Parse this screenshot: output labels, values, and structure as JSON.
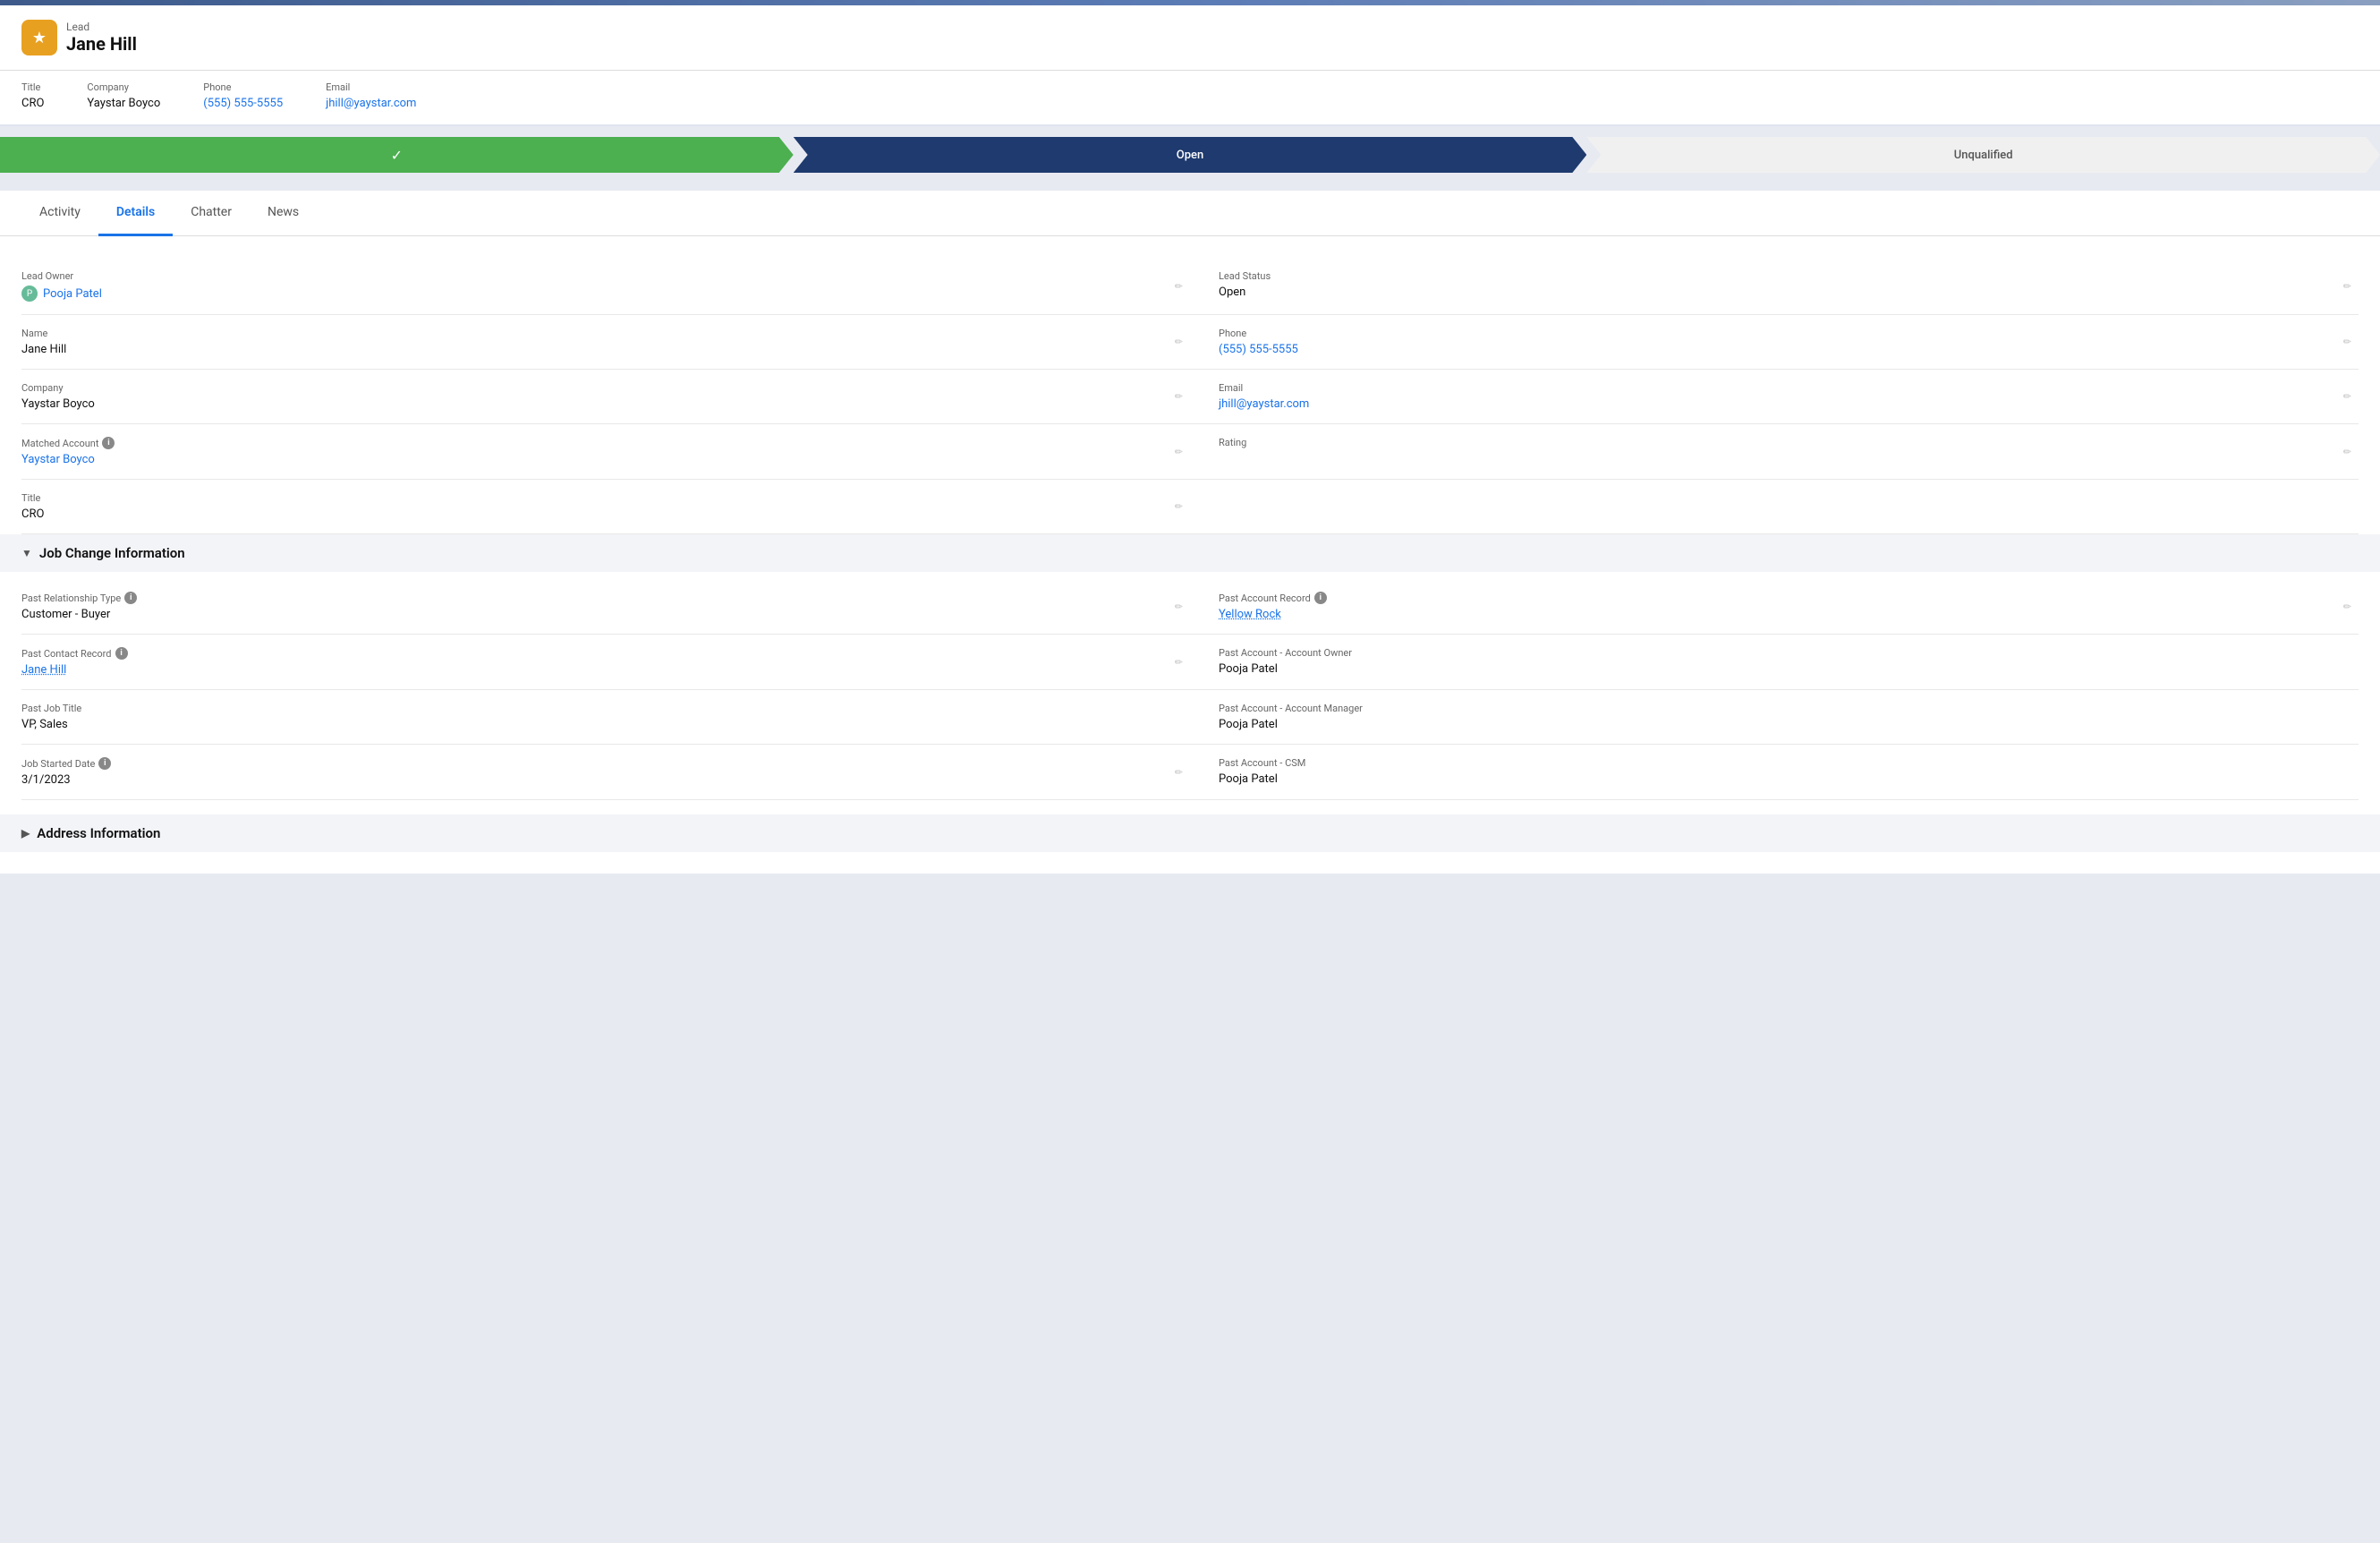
{
  "topbar": {
    "stripe_color": "#3d5a8a"
  },
  "header": {
    "record_type": "Lead",
    "name": "Jane Hill",
    "icon_symbol": "★"
  },
  "info_bar": {
    "title_label": "Title",
    "title_value": "CRO",
    "company_label": "Company",
    "company_value": "Yaystar Boyco",
    "phone_label": "Phone",
    "phone_value": "(555) 555-5555",
    "email_label": "Email",
    "email_value": "jhill@yaystar.com"
  },
  "progress": {
    "steps": [
      {
        "label": "✓",
        "state": "done"
      },
      {
        "label": "Open",
        "state": "active"
      },
      {
        "label": "Unqualified",
        "state": "inactive"
      }
    ]
  },
  "tabs": [
    {
      "label": "Activity",
      "active": false
    },
    {
      "label": "Details",
      "active": true
    },
    {
      "label": "Chatter",
      "active": false
    },
    {
      "label": "News",
      "active": false
    }
  ],
  "fields": {
    "lead_owner_label": "Lead Owner",
    "lead_owner_value": "Pooja Patel",
    "lead_status_label": "Lead Status",
    "lead_status_value": "Open",
    "name_label": "Name",
    "name_value": "Jane Hill",
    "phone_label": "Phone",
    "phone_value": "(555) 555-5555",
    "company_label": "Company",
    "company_value": "Yaystar Boyco",
    "email_label": "Email",
    "email_value": "jhill@yaystar.com",
    "matched_account_label": "Matched Account",
    "matched_account_value": "Yaystar Boyco",
    "rating_label": "Rating",
    "rating_value": "",
    "title_label": "Title",
    "title_value": "CRO"
  },
  "job_change_section": {
    "title": "Job Change Information",
    "past_relationship_type_label": "Past Relationship Type",
    "past_relationship_type_value": "Customer - Buyer",
    "past_account_record_label": "Past Account Record",
    "past_account_record_value": "Yellow Rock",
    "past_contact_record_label": "Past Contact Record",
    "past_contact_record_value": "Jane Hill",
    "past_account_owner_label": "Past Account - Account Owner",
    "past_account_owner_value": "Pooja Patel",
    "past_job_title_label": "Past Job Title",
    "past_job_title_value": "VP, Sales",
    "past_account_manager_label": "Past Account - Account Manager",
    "past_account_manager_value": "Pooja Patel",
    "job_started_date_label": "Job Started Date",
    "job_started_date_value": "3/1/2023",
    "past_account_csm_label": "Past Account - CSM",
    "past_account_csm_value": "Pooja Patel"
  },
  "address_section": {
    "title": "Address Information"
  }
}
